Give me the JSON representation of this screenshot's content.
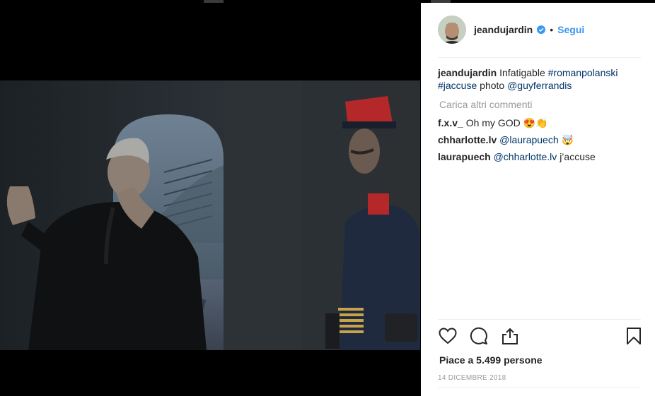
{
  "post": {
    "username": "jeandujardin",
    "verified": true,
    "follow_label": "Segui",
    "separator": "•"
  },
  "caption": {
    "username": "jeandujardin",
    "text_1": "Infatigable",
    "hashtag_1": "#romanpolanski",
    "hashtag_2": "#jaccuse",
    "text_2": "photo",
    "mention": "@guyferrandis"
  },
  "load_more_label": "Carica altri commenti",
  "comments": [
    {
      "user": "f.x.v_",
      "text": "Oh my GOD 😍👏"
    },
    {
      "user": "chharlotte.lv",
      "mention": "@laurapuech",
      "text": "🤯"
    },
    {
      "user": "laurapuech",
      "mention": "@chharlotte.lv",
      "text": "j’accuse"
    }
  ],
  "likes_label": "Piace a 5.499 persone",
  "date_label": "14 DICEMBRE 2018",
  "icons": [
    "heart-icon",
    "comment-icon",
    "share-icon",
    "bookmark-icon",
    "verified-badge-icon"
  ],
  "colors": {
    "link": "#003569",
    "follow": "#3897f0",
    "verified": "#3897f0"
  }
}
